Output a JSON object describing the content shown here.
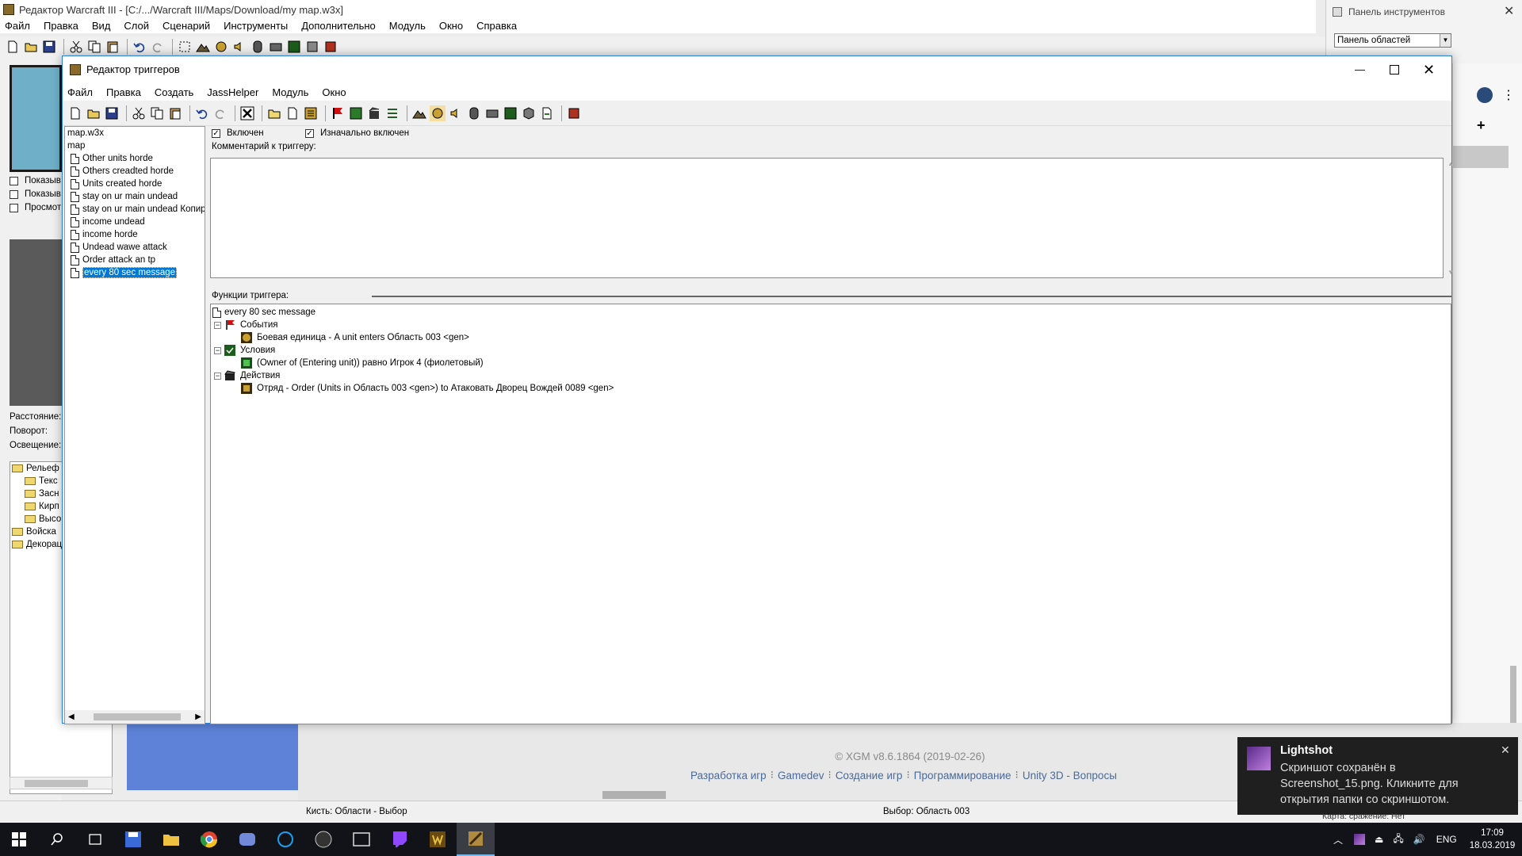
{
  "outer": {
    "title": "Редактор Warcraft III  - [C:/.../Warcraft III/Maps/Download/my map.w3x]",
    "menu": [
      "Файл",
      "Правка",
      "Вид",
      "Слой",
      "Сценарий",
      "Инструменты",
      "Дополнительно",
      "Модуль",
      "Окно",
      "Справка"
    ],
    "left_checkboxes": [
      "Показыв",
      "Показыв",
      "Просмот"
    ],
    "left_labels": [
      "Расстояние:",
      "Поворот:",
      "Освещение:"
    ],
    "left_tree": [
      "Рельеф",
      "Текс",
      "Засн",
      "Кирп",
      "Высо",
      "Войска",
      "Декорац"
    ]
  },
  "palette": {
    "title": "Панель инструментов",
    "select_value": "Панель областей"
  },
  "trigger_editor": {
    "title": "Редактор триггеров",
    "menu": [
      "Файл",
      "Правка",
      "Создать",
      "JassHelper",
      "Модуль",
      "Окно"
    ],
    "tree": {
      "root": "map.w3x",
      "category": "map",
      "items": [
        "Other units horde",
        "Others creadted horde",
        "Units created horde",
        "stay on ur main undead",
        "stay on ur main undead Копиро",
        "income undead",
        "income horde",
        "Undead wawe attack",
        "Order attack an tp",
        "every 80 sec message"
      ],
      "selected_index": 9
    },
    "enabled_label": "Включен",
    "initially_enabled_label": "Изначально включен",
    "comment_label": "Комментарий к триггеру:",
    "functions_label": "Функции триггера:",
    "functions": {
      "trigger_name": "every 80 sec message",
      "events_label": "События",
      "event": "Боевая единица - A unit enters Область 003 <gen>",
      "conditions_label": "Условия",
      "condition": "(Owner of (Entering unit)) равно Игрок 4 (фиолетовый)",
      "actions_label": "Действия",
      "action": "Отряд - Order (Units in Область 003 <gen>) to Атаковать Дворец Вождей 0089 <gen>"
    }
  },
  "footer": {
    "copyright": "© XGM v8.6.1864 (2019-02-26)",
    "links": [
      "Разработка игр",
      "Gamedev",
      "Создание игр",
      "Программирование",
      "Unity 3D - Вопросы"
    ],
    "status_brush": "Кисть: Области - Выбор",
    "status_selection": "Выбор: Область 003",
    "status_map": "Карта: сражение: Нет"
  },
  "toast": {
    "app": "Lightshot",
    "message": "Скриншот сохранён в Screenshot_15.png. Кликните для открытия папки со скриншотом."
  },
  "taskbar": {
    "lang": "ENG",
    "time": "17:09",
    "date": "18.03.2019"
  }
}
